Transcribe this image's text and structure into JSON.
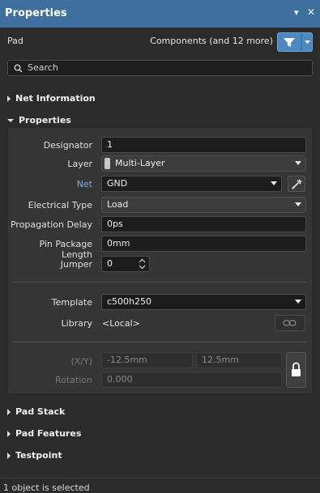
{
  "window": {
    "title": "Properties"
  },
  "header": {
    "object_type": "Pad",
    "filter_label": "Components (and 12 more)"
  },
  "search": {
    "placeholder": "Search"
  },
  "sections": {
    "net_information": "Net Information",
    "properties": "Properties",
    "pad_stack": "Pad Stack",
    "pad_features": "Pad Features",
    "testpoint": "Testpoint"
  },
  "properties": {
    "designator_label": "Designator",
    "designator_value": "1",
    "layer_label": "Layer",
    "layer_value": "Multi-Layer",
    "net_label": "Net",
    "net_value": "GND",
    "electrical_type_label": "Electrical Type",
    "electrical_type_value": "Load",
    "propagation_delay_label": "Propagation Delay",
    "propagation_delay_value": "0ps",
    "pin_package_length_label": "Pin Package Length",
    "pin_package_length_value": "0mm",
    "jumper_label": "Jumper",
    "jumper_value": "0",
    "template_label": "Template",
    "template_value": "c500h250",
    "library_label": "Library",
    "library_value": "<Local>",
    "xy_label": "(X/Y)",
    "x_value": "-12.5mm",
    "y_value": "12.5mm",
    "rotation_label": "Rotation",
    "rotation_value": "0.000"
  },
  "status": {
    "text": "1 object is selected"
  },
  "colors": {
    "titlebar": "#3f6f9d",
    "filter_button": "#4f88c0",
    "net_label": "#7fb2e5"
  }
}
